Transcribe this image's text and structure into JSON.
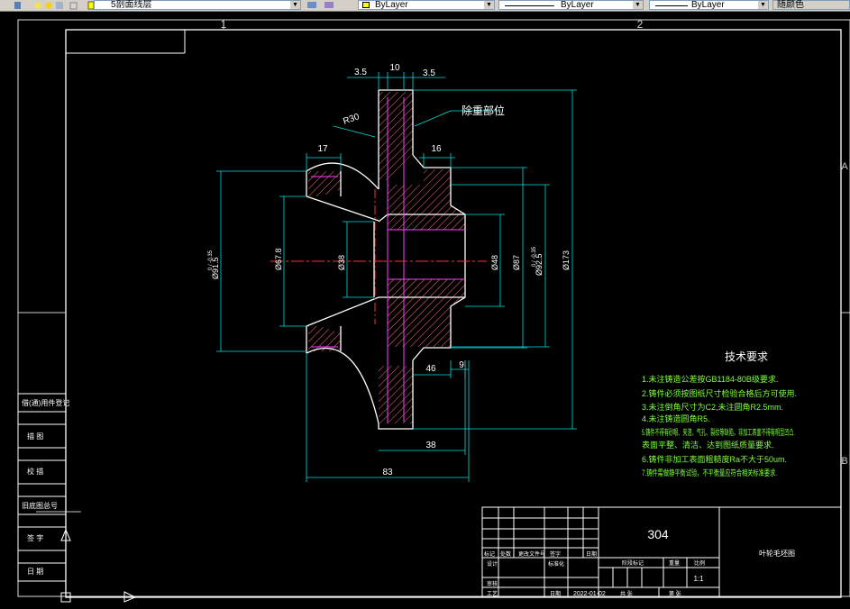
{
  "toolbar": {
    "layer_name": "5剖面线层",
    "color": "ByLayer",
    "linetype": "ByLayer",
    "lineweight": "ByLayer",
    "plotstyle": "随颜色",
    "color_swatch": "#ffff00"
  },
  "border": {
    "zone_top": [
      "1",
      "2"
    ],
    "zone_right": [
      "A",
      "B"
    ]
  },
  "dims": {
    "d35_left": "3.5",
    "d10": "10",
    "d35_right": "3.5",
    "r30": "R30",
    "d17": "17",
    "d16": "16",
    "d46": "46",
    "d9": "9",
    "d38": "38",
    "d83": "83",
    "dia_left1": "Ø91.5",
    "dia_left1_tol": "0 / -0.35",
    "dia_left2": "Ø67.8",
    "dia_left3": "Ø38",
    "dia_48": "Ø48",
    "dia_87": "Ø87",
    "dia_925": "Ø92.5",
    "dia_925_tol": "0 / -0.35",
    "dia_173": "Ø173"
  },
  "callout": "除重部位",
  "tech": {
    "title": "技术要求",
    "items": [
      "1.未注铸造公差按GB1184-80B级要求.",
      "2.铸件必须按图纸尺寸检验合格后方可使用.",
      "3.未注倒角尺寸为C2,未注圆角R2.5mm.",
      "4.未注铸造圆角R5.",
      "5.铸件不得有砂眼、夹渣、气孔、裂纹等缺陷，非加工表面不得有明显凹凸.",
      "   表面平整、清洁、达到图纸质量要求.",
      "6.铸件非加工表面粗糙度Ra不大于50um.",
      "7.铸件需做静平衡试验，不平衡量应符合相关标准要求."
    ]
  },
  "title_block": {
    "material": "304",
    "part_name": "叶轮毛坯图",
    "scale": "1:1",
    "date": "2022-01-02",
    "headers": {
      "mark": "标记",
      "count": "处数",
      "change": "更改文件号",
      "sign": "签字",
      "date_h": "日期",
      "design": "设计",
      "std": "标准化",
      "check": "审核",
      "process": "工艺",
      "stage": "阶段标记",
      "weight": "重量",
      "ratio": "比例",
      "total": "共 张",
      "sheet": "第 张",
      "date_label": "日期"
    }
  },
  "left_block": [
    "借(通)用件登记",
    "描 图",
    "校 描",
    "旧底图总号",
    "签 字",
    "日 期"
  ]
}
